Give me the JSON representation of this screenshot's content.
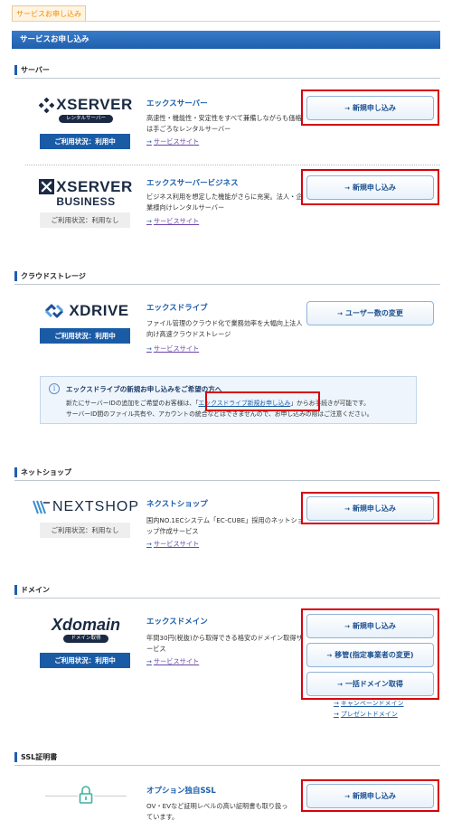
{
  "tab": {
    "label": "サービスお申し込み"
  },
  "banner": {
    "title": "サービスお申し込み"
  },
  "sections": {
    "server": "サーバー",
    "cloud": "クラウドストレージ",
    "shop": "ネットショップ",
    "domain": "ドメイン",
    "ssl": "SSL証明書"
  },
  "services": {
    "xserver": {
      "logo": "XSERVER",
      "logo_sub": "レンタルサーバー",
      "status": "ご利用状況：利用中",
      "name": "エックスサーバー",
      "desc": "高速性・機能性・安定性をすべて兼備しながらも価格は手ごろなレンタルサーバー",
      "link": "サービスサイト",
      "button": "新規申し込み"
    },
    "xbusiness": {
      "logo": "XSERVER",
      "logo_sub": "BUSINESS",
      "status": "ご利用状況：利用なし",
      "name": "エックスサーバービジネス",
      "desc": "ビジネス利用を想定した機能がさらに充実。法人・企業様向けレンタルサーバー",
      "link": "サービスサイト",
      "button": "新規申し込み"
    },
    "xdrive": {
      "logo": "XDRIVE",
      "status": "ご利用状況：利用中",
      "name": "エックスドライブ",
      "desc": "ファイル管理のクラウド化で業務効率を大幅向上法人向け高速クラウドストレージ",
      "link": "サービスサイト",
      "button": "ユーザー数の変更"
    },
    "nextshop": {
      "logo": "NEXTSHOP",
      "status": "ご利用状況：利用なし",
      "name": "ネクストショップ",
      "desc": "国内NO.1ECシステム「EC-CUBE」採用のネットショップ作成サービス",
      "link": "サービスサイト",
      "button": "新規申し込み"
    },
    "xdomain": {
      "logo": "Xdomain",
      "logo_sub": "ドメイン取得",
      "status": "ご利用状況：利用中",
      "name": "エックスドメイン",
      "desc": "年間30円(税抜)から取得できる格安のドメイン取得サービス",
      "link": "サービスサイト",
      "buttons": [
        "新規申し込み",
        "移管(指定事業者の変更)",
        "一括ドメイン取得"
      ],
      "sublinks": [
        "キャンペーンドメイン",
        "プレゼントドメイン"
      ]
    },
    "ssl": {
      "name": "オプション独自SSL",
      "desc": "OV・EVなど証明レベルの高い証明書も取り扱っています。",
      "button": "新規申し込み"
    }
  },
  "info": {
    "title": "エックスドライブの新規お申し込みをご希望の方へ",
    "line1_pre": "新たにサーバーIDの追加をご希望のお客様は、「",
    "line1_link": "エックスドライブ新規お申し込み",
    "line1_post": "」からお手続きが可能です。",
    "line2": "サーバーID間のファイル共有や、アカウントの統合などはできませんので、お申し込みの際はご注意ください。"
  },
  "colors": {
    "accent": "#1b5eaa",
    "highlight": "#d9000d",
    "tab": "#f08c00"
  }
}
